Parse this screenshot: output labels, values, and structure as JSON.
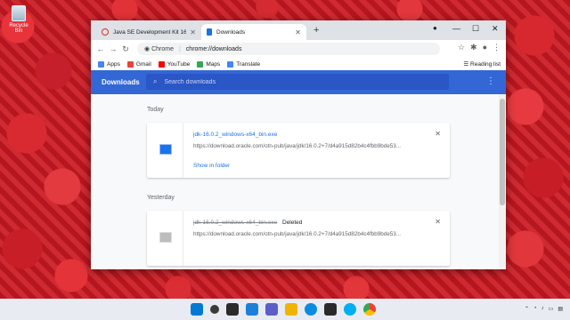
{
  "desktop": {
    "recycle_bin_label": "Recycle Bin"
  },
  "tabs": [
    {
      "title": "Java SE Development Kit 16 - Do",
      "icon": "oracle-icon",
      "active": false
    },
    {
      "title": "Downloads",
      "icon": "downloads-icon",
      "active": true
    }
  ],
  "toolbar": {
    "site_chip": "Chrome",
    "url": "chrome://downloads"
  },
  "bookmarks": [
    {
      "label": "Apps",
      "icon": "apps-grid-icon",
      "color": "#4285f4"
    },
    {
      "label": "Gmail",
      "icon": "gmail-icon",
      "color": "#ea4335"
    },
    {
      "label": "YouTube",
      "icon": "youtube-icon",
      "color": "#ff0000"
    },
    {
      "label": "Maps",
      "icon": "maps-icon",
      "color": "#34a853"
    },
    {
      "label": "Translate",
      "icon": "translate-icon",
      "color": "#4285f4"
    }
  ],
  "reading_list": "Reading list",
  "downloads": {
    "title": "Downloads",
    "search_placeholder": "Search downloads",
    "groups": [
      {
        "date": "Today",
        "items": [
          {
            "filename": "jdk-16.0.2_windows-x64_bin.exe",
            "url": "https://download.oracle.com/otn-pub/java/jdk/16.0.2+7/d4a915d82b4c4fbb9bde53...",
            "action": "Show in folder",
            "status": ""
          }
        ]
      },
      {
        "date": "Yesterday",
        "items": [
          {
            "filename": "jdk-16.0.2_windows-x64_bin.exe",
            "url": "https://download.oracle.com/otn-pub/java/jdk/16.0.2+7/d4a915d82b4c4fbb9bde53...",
            "action": "",
            "status": "Deleted"
          }
        ]
      }
    ]
  },
  "colors": {
    "accent": "#3367d6",
    "link": "#1a73e8"
  }
}
